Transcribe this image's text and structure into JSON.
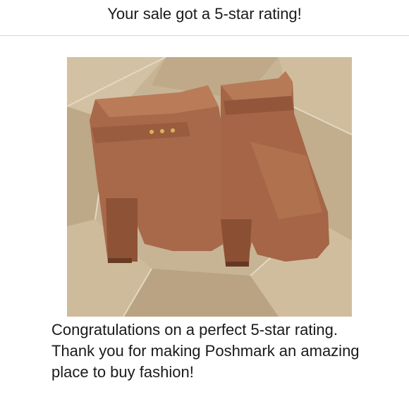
{
  "header": {
    "title": "Your sale got a 5-star rating!"
  },
  "listing": {
    "image_icon": "brown-ankle-boots-photo"
  },
  "message": {
    "text": "Congratulations on a perfect 5-star rating. Thank you for making Poshmark an amazing place to buy fashion!"
  },
  "rating": {
    "stars": 5,
    "max_stars": 5
  },
  "colors": {
    "background": "#ffffff",
    "text": "#1a1a1a",
    "divider": "#d6d6d6",
    "boot_leather": "#a8694a",
    "tile_floor": "#c9b79a"
  }
}
